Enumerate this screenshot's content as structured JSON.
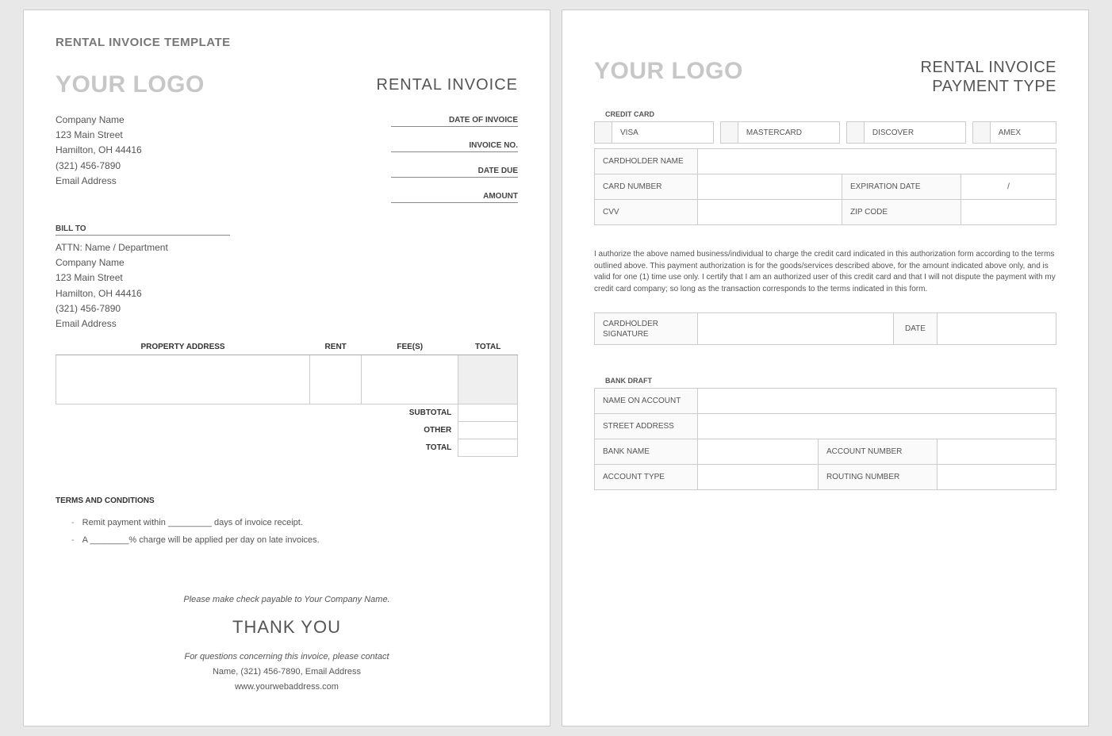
{
  "page1": {
    "template_title": "RENTAL INVOICE TEMPLATE",
    "logo": "YOUR LOGO",
    "invoice_title": "RENTAL INVOICE",
    "company": {
      "name": "Company Name",
      "street": "123 Main Street",
      "city": "Hamilton, OH  44416",
      "phone": "(321) 456-7890",
      "email": "Email Address"
    },
    "meta": {
      "date_of_invoice": "DATE OF INVOICE",
      "invoice_no": "INVOICE NO.",
      "date_due": "DATE DUE",
      "amount": "AMOUNT"
    },
    "bill_to_label": "BILL TO",
    "bill_to": {
      "attn": "ATTN: Name / Department",
      "name": "Company Name",
      "street": "123 Main Street",
      "city": "Hamilton, OH  44416",
      "phone": "(321) 456-7890",
      "email": "Email Address"
    },
    "table_headers": {
      "property": "PROPERTY ADDRESS",
      "rent": "RENT",
      "fees": "FEE(S)",
      "total": "TOTAL"
    },
    "totals": {
      "subtotal": "SUBTOTAL",
      "other": "OTHER",
      "total": "TOTAL"
    },
    "terms_title": "TERMS AND CONDITIONS",
    "terms": {
      "line1": "Remit payment within _________ days of invoice receipt.",
      "line2": "A ________% charge will be applied per day on late invoices."
    },
    "footer": {
      "payable": "Please make check payable to Your Company Name.",
      "thank_you": "THANK YOU",
      "questions": "For questions concerning this invoice, please contact",
      "contact": "Name, (321) 456-7890, Email Address",
      "web": "www.yourwebaddress.com"
    }
  },
  "page2": {
    "logo": "YOUR LOGO",
    "title1": "RENTAL INVOICE",
    "title2": "PAYMENT TYPE",
    "cc_section": "CREDIT CARD",
    "cc_types": {
      "visa": "VISA",
      "mc": "MASTERCARD",
      "discover": "DISCOVER",
      "amex": "AMEX"
    },
    "cc_fields": {
      "cardholder": "CARDHOLDER NAME",
      "card_number": "CARD NUMBER",
      "exp": "EXPIRATION DATE",
      "exp_val": "/",
      "cvv": "CVV",
      "zip": "ZIP CODE"
    },
    "auth_text": "I authorize the above named business/individual to charge the credit card indicated in this authorization form according to the terms outlined above. This payment authorization is for the goods/services described above, for the amount indicated above only, and is valid for one (1) time use only. I certify that I am an authorized user of this credit card and that I will not dispute the payment with my credit card company; so long as the transaction corresponds to the terms indicated in this form.",
    "sig": {
      "cardholder_sig": "CARDHOLDER SIGNATURE",
      "date": "DATE"
    },
    "bank_section": "BANK DRAFT",
    "bank_fields": {
      "name_on_account": "NAME ON ACCOUNT",
      "street": "STREET ADDRESS",
      "bank_name": "BANK NAME",
      "account_number": "ACCOUNT NUMBER",
      "account_type": "ACCOUNT TYPE",
      "routing_number": "ROUTING NUMBER"
    }
  }
}
